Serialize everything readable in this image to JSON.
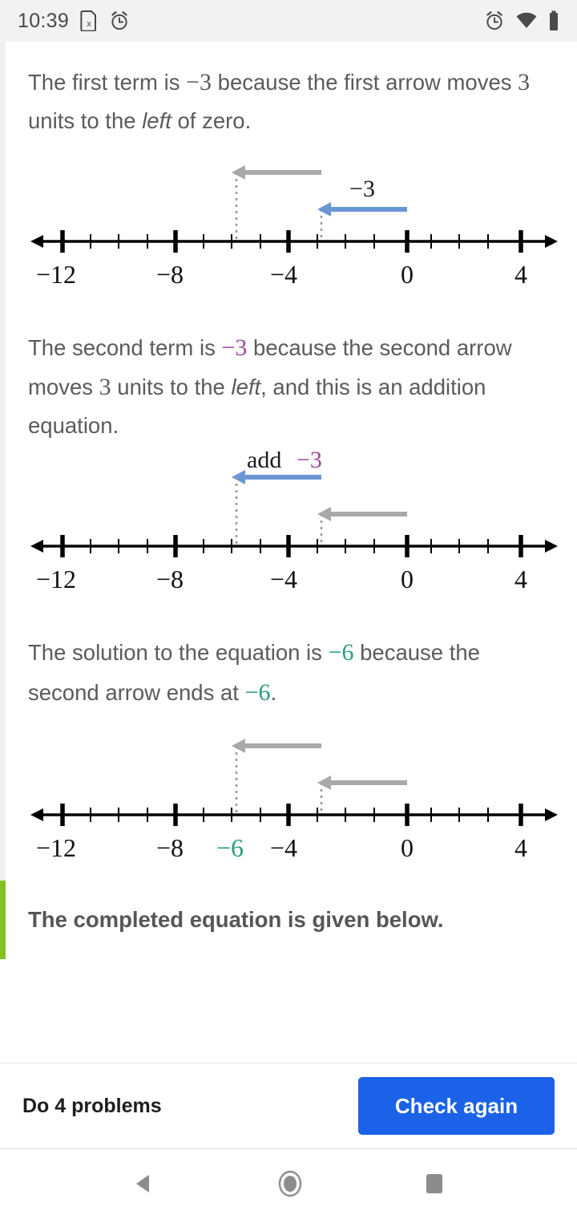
{
  "status_bar": {
    "time": "10:39",
    "left_icons": [
      "sim-card-x-icon",
      "alarm-icon"
    ],
    "right_icons": [
      "alarm-icon",
      "wifi-icon",
      "battery-icon"
    ]
  },
  "colors": {
    "blue_arrow": "#6b96d6",
    "gray_arrow": "#a9a9a9",
    "purple": "#9b4a9e",
    "green": "#2a9d7d",
    "accent_green_bar": "#83c225",
    "button_blue": "#1b62e8"
  },
  "steps": [
    {
      "id": "step-1",
      "text_parts": [
        {
          "t": "The first term is ",
          "style": "normal"
        },
        {
          "t": "−3",
          "style": "math"
        },
        {
          "t": " because the first arrow moves ",
          "style": "normal"
        },
        {
          "t": "3",
          "style": "math"
        },
        {
          "t": " units to the ",
          "style": "normal"
        },
        {
          "t": "left",
          "style": "italic"
        },
        {
          "t": " of zero.",
          "style": "normal"
        }
      ],
      "text_plain": "The first term is −3 because the first arrow moves 3 units to the left of zero.",
      "diagram": {
        "label": "",
        "label_black": "",
        "label_colored": "−3",
        "label_color": "purple_none",
        "arrows": [
          {
            "name": "upper-arrow",
            "from": -3,
            "to": -6,
            "color": "#a9a9a9",
            "row": "upper"
          },
          {
            "name": "lower-arrow",
            "from": 0,
            "to": -3,
            "color": "#6b96d6",
            "row": "lower",
            "label": "−3"
          }
        ],
        "dotted_at": [
          -6,
          -3
        ]
      }
    },
    {
      "id": "step-2",
      "text_parts": [
        {
          "t": "The second term is ",
          "style": "normal"
        },
        {
          "t": "−3",
          "style": "math-purple"
        },
        {
          "t": " because the second arrow moves ",
          "style": "normal"
        },
        {
          "t": "3",
          "style": "math"
        },
        {
          "t": " units to the ",
          "style": "normal"
        },
        {
          "t": "left",
          "style": "italic"
        },
        {
          "t": ", and this is an addition equation.",
          "style": "normal"
        }
      ],
      "text_plain": "The second term is −3 because the second arrow moves 3 units to the left, and this is an addition equation.",
      "diagram": {
        "label_black": "add",
        "label_colored": "−3",
        "arrows": [
          {
            "name": "upper-arrow",
            "from": -3,
            "to": -6,
            "color": "#6b96d6",
            "row": "upper",
            "label": "add −3"
          },
          {
            "name": "lower-arrow",
            "from": 0,
            "to": -3,
            "color": "#a9a9a9",
            "row": "lower"
          }
        ],
        "dotted_at": [
          -6,
          -3
        ]
      }
    },
    {
      "id": "step-3",
      "text_parts": [
        {
          "t": "The solution to the equation is ",
          "style": "normal"
        },
        {
          "t": "−6",
          "style": "math-green"
        },
        {
          "t": " because the second arrow ends at ",
          "style": "normal"
        },
        {
          "t": "−6",
          "style": "math-green"
        },
        {
          "t": ".",
          "style": "normal"
        }
      ],
      "text_plain": "The solution to the equation is −6 because the second arrow ends at −6.",
      "diagram": {
        "arrows": [
          {
            "name": "upper-arrow",
            "from": -3,
            "to": -6,
            "color": "#a9a9a9",
            "row": "upper"
          },
          {
            "name": "lower-arrow",
            "from": 0,
            "to": -3,
            "color": "#a9a9a9",
            "row": "lower"
          }
        ],
        "dotted_at": [
          -6,
          -3
        ],
        "highlight_label": {
          "value": "−6",
          "at": -6,
          "color": "#2a9d7d"
        }
      }
    },
    {
      "id": "step-final",
      "text_plain": "The completed equation is given below."
    }
  ],
  "number_line": {
    "min": -13,
    "max": 5,
    "major_ticks": [
      -12,
      -8,
      -4,
      0,
      4
    ],
    "major_labels": [
      "−12",
      "−8",
      "−4",
      "0",
      "4"
    ],
    "minor_tick_step": 1,
    "axis_arrows_both_ends": true
  },
  "bottom_bar": {
    "do_problems_label": "Do 4 problems",
    "check_button_label": "Check again"
  },
  "nav_bar": {
    "back_label": "back-button",
    "home_label": "home-button",
    "recents_label": "recents-button"
  }
}
